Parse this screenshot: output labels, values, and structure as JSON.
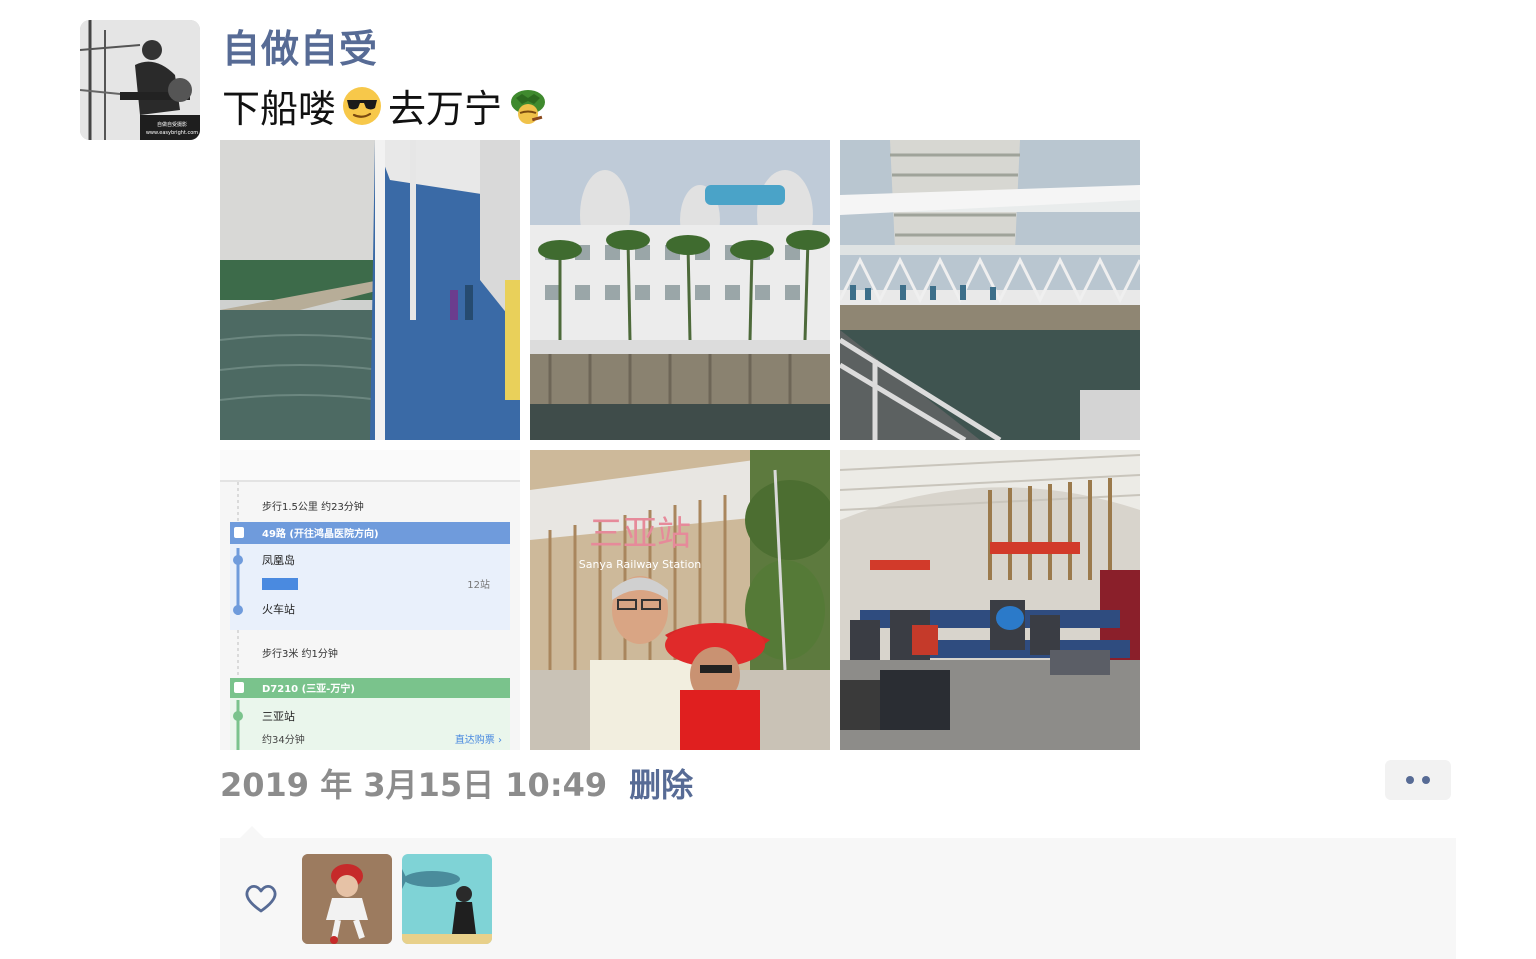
{
  "post": {
    "author": "自做自受",
    "text_parts": [
      "下船喽",
      "去万宁"
    ],
    "emojis": [
      "sunglasses-emoji-icon",
      "turtle-emoji-icon"
    ],
    "timestamp": "2019 年 3月15日 10:49",
    "delete_label": "删除"
  },
  "photos": [
    {
      "name": "ferry-deck-photo"
    },
    {
      "name": "resort-hotel-photo"
    },
    {
      "name": "pier-walkway-photo"
    },
    {
      "name": "transit-route-photo"
    },
    {
      "name": "sanya-station-selfie-photo"
    },
    {
      "name": "station-waiting-hall-photo"
    }
  ],
  "transit_map": {
    "walk1": "步行1.5公里 约23分钟",
    "bus_line": "49路 (开往鸿晶医院方向)",
    "stop1": "凤凰岛",
    "stops_count": "12站",
    "stop2": "火车站",
    "walk2": "步行3米 约1分钟",
    "train_line": "D7210 (三亚-万宁)",
    "stop3": "三亚站",
    "duration": "约34分钟",
    "buy_ticket": "直达购票 ›"
  },
  "station_sign": {
    "chinese": "三亚站",
    "english": "Sanya Railway Station"
  },
  "avatar_caption": {
    "line1": "自做自受摄影",
    "line2": "www.easybright.com"
  },
  "likes": {
    "users": [
      "liker-avatar-child",
      "liker-avatar-aquarium"
    ]
  },
  "colors": {
    "link": "#576b95",
    "meta_gray": "#8c8c8c",
    "likes_bg": "#f7f7f7"
  }
}
